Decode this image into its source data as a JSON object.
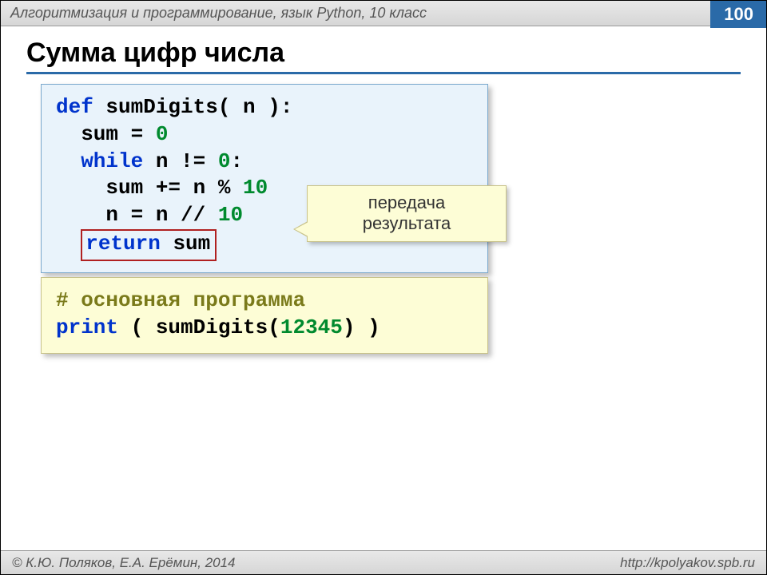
{
  "header": {
    "subject": "Алгоритмизация и программирование, язык Python, 10 класс",
    "page": "100"
  },
  "title": "Сумма цифр числа",
  "code1": {
    "l1a": "def",
    "l1b": " sumDigits( n ):",
    "l2a": "  sum = ",
    "l2b": "0",
    "l3a": "  while",
    "l3b": " n != ",
    "l3c": "0",
    "l3d": ":",
    "l4a": "    sum += n % ",
    "l4b": "10",
    "l5a": "    n = n // ",
    "l5b": "10",
    "l6a": "return",
    "l6b": " sum"
  },
  "callout": {
    "line1": "передача",
    "line2": "результата"
  },
  "code2": {
    "l1": "# основная программа",
    "l2a": "print",
    "l2b": " ( sumDigits(",
    "l2c": "12345",
    "l2d": ") )"
  },
  "footer": {
    "left": "© К.Ю. Поляков, Е.А. Ерёмин, 2014",
    "right": "http://kpolyakov.spb.ru"
  }
}
